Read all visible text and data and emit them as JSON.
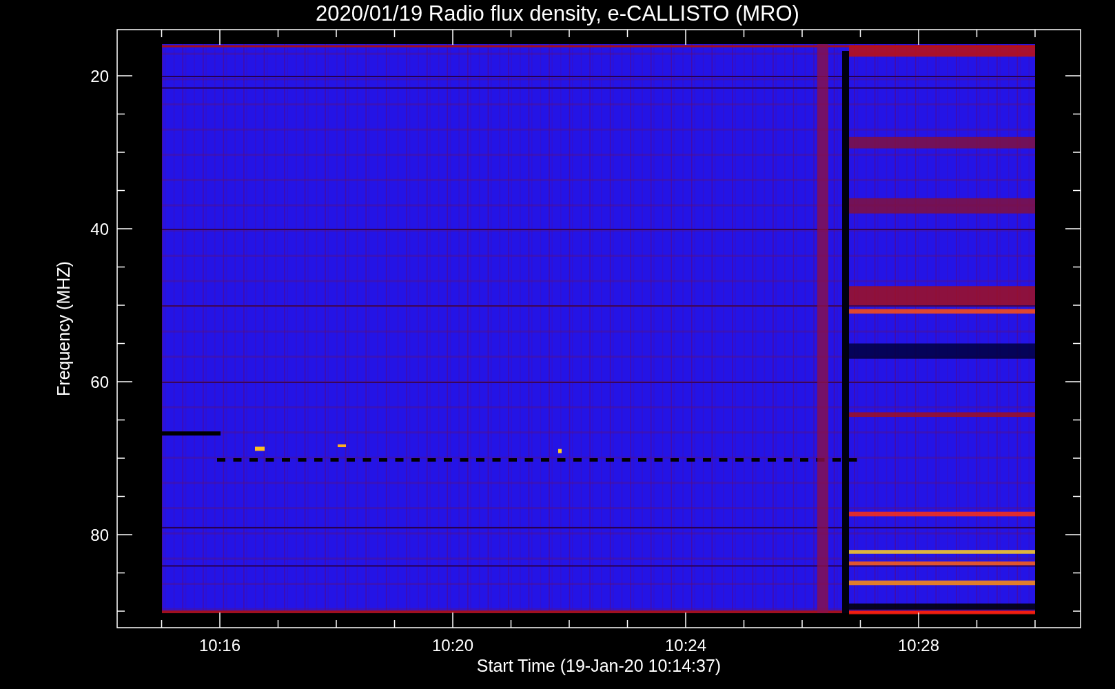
{
  "chart": {
    "title": "2020/01/19  Radio flux density, e-CALLISTO (MRO)",
    "xlabel": "Start Time (19-Jan-20 10:14:37)",
    "ylabel": "Frequency (MHZ)",
    "xticks": [
      "10:16",
      "10:20",
      "10:24",
      "10:28"
    ],
    "yticks": [
      "20",
      "40",
      "60",
      "80"
    ]
  }
}
